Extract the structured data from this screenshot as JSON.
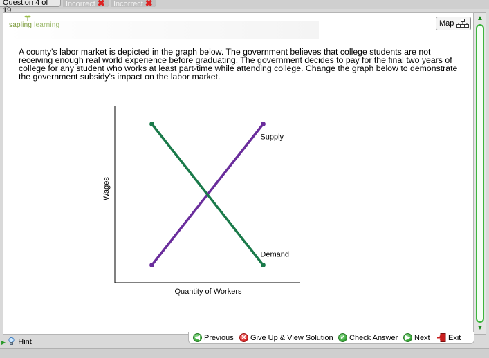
{
  "tabs": [
    {
      "label": "Question 4 of 19"
    },
    {
      "label": "Incorrect",
      "status": "incorrect"
    },
    {
      "label": "Incorrect",
      "status": "incorrect"
    }
  ],
  "logo": {
    "part1": "sapling",
    "part2": "learning"
  },
  "map_button": {
    "label": "Map"
  },
  "question_text": "A county's labor market is depicted in the graph below. The government believes that college students are not receiving enough real world experience before graduating. The government decides to pay for the final two years of college for any student who works at least part-time while attending college. Change the graph below to demonstrate the government subsidy's impact on the labor market.",
  "chart_data": {
    "type": "line",
    "xlabel": "Quantity of Workers",
    "ylabel": "Wages",
    "grid": false,
    "series": [
      {
        "name": "Supply",
        "color": "#6a2d9c",
        "points": [
          [
            0.2,
            0.1
          ],
          [
            0.8,
            0.9
          ]
        ]
      },
      {
        "name": "Demand",
        "color": "#1a7a4a",
        "points": [
          [
            0.2,
            0.9
          ],
          [
            0.8,
            0.1
          ]
        ]
      }
    ]
  },
  "toolbar": {
    "previous": "Previous",
    "giveup": "Give Up & View Solution",
    "check": "Check Answer",
    "next": "Next",
    "exit": "Exit"
  },
  "hint": {
    "label": "Hint"
  },
  "colors": {
    "accent_green": "#3db53d",
    "incorrect_red": "#dd2222"
  }
}
